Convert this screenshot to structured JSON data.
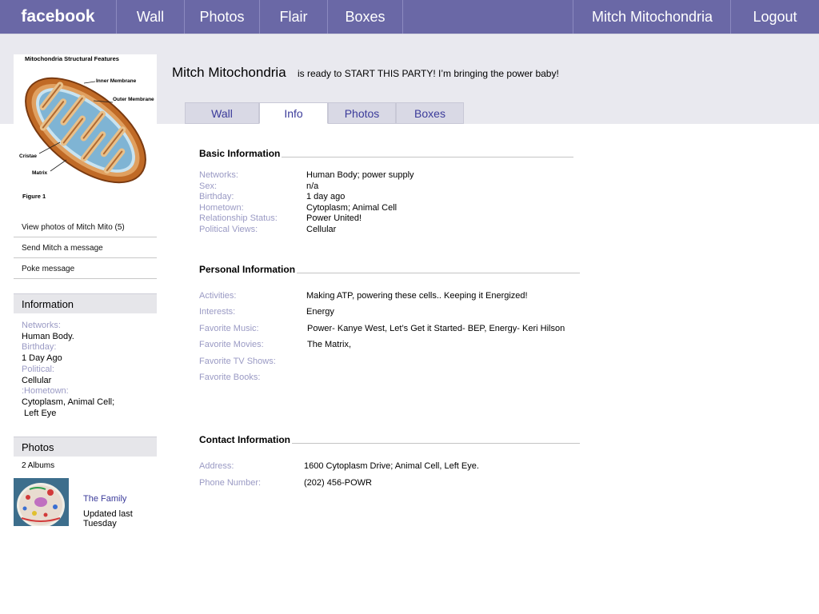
{
  "nav": {
    "logo": "facebook",
    "items": [
      "Wall",
      "Photos",
      "Flair",
      "Boxes"
    ],
    "user": "Mitch Mitochondria",
    "logout": "Logout"
  },
  "profile_pic": {
    "title": "Mitochondria Structural Features",
    "labels": {
      "inner": "Inner Membrane",
      "outer": "Outer Membrane",
      "cristae": "Cristae",
      "matrix": "Matrix",
      "figure": "Figure 1"
    }
  },
  "sidebar": {
    "links": [
      "View photos of Mitch Mito (5)",
      "Send Mitch a message",
      "Poke message"
    ],
    "info_heading": "Information",
    "info": [
      {
        "label": "Networks:",
        "value": "Human Body."
      },
      {
        "label": "Birthday:",
        "value": "1 Day Ago"
      },
      {
        "label": "Political:",
        "value": "Cellular"
      },
      {
        "label": ":Hometown:",
        "value": "Cytoplasm, Animal Cell;",
        "value2": " Left Eye"
      }
    ],
    "photos_heading": "Photos",
    "albums_count": "2 Albums",
    "album": {
      "title": "The Family",
      "updated": "Updated last Tuesday"
    }
  },
  "profile": {
    "name": "Mitch Mitochondria",
    "status": "is ready to START THIS PARTY! I’m bringing the power baby!"
  },
  "tabs": {
    "items": [
      "Wall",
      "Info",
      "Photos",
      "Boxes"
    ],
    "active": "Info"
  },
  "basic": {
    "title": "Basic Information",
    "rows": [
      {
        "k": "Networks:",
        "v": "Human Body; power supply"
      },
      {
        "k": "Sex:",
        "v": "n/a"
      },
      {
        "k": "Birthday:",
        "v": "1 day ago"
      },
      {
        "k": "Hometown:",
        "v": "Cytoplasm; Animal Cell"
      },
      {
        "k": "Relationship Status:",
        "v": "Power United!"
      },
      {
        "k": "Political Views:",
        "v": "Cellular"
      }
    ]
  },
  "personal": {
    "title": "Personal Information",
    "rows": [
      {
        "k": "Activities:",
        "v": "Making ATP, powering these cells.. Keeping it Energized!"
      },
      {
        "k": "Interests:",
        "v": "Energy"
      },
      {
        "k": "Favorite Music:",
        "v": "Power- Kanye West, Let’s Get it Started- BEP, Energy- Keri Hilson"
      },
      {
        "k": "Favorite Movies:",
        "v": "The Matrix,"
      },
      {
        "k": "Favorite TV Shows:",
        "v": ""
      },
      {
        "k": "Favorite Books:",
        "v": ""
      }
    ]
  },
  "contact": {
    "title": "Contact Information",
    "rows": [
      {
        "k": "Address:",
        "v": "1600 Cytoplasm Drive; Animal Cell, Left Eye."
      },
      {
        "k": "Phone Number:",
        "v": "(202) 456-POWR"
      }
    ]
  },
  "colors": {
    "nav_bg": "#6a68a6",
    "band_bg": "#e9e9ef",
    "label": "#9a9ac4",
    "link": "#3b3b9a"
  }
}
